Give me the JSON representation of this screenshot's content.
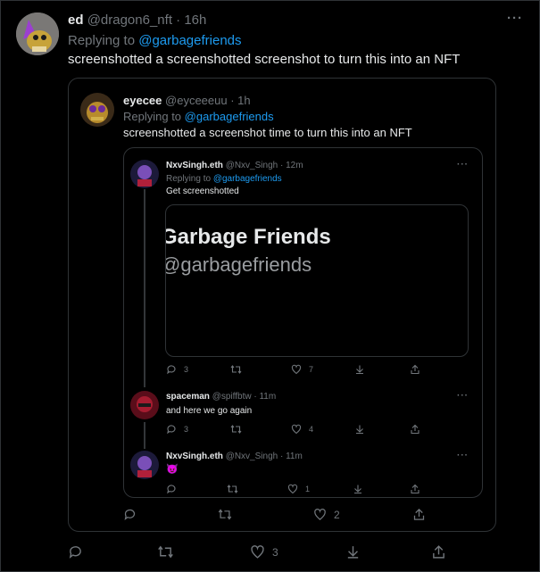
{
  "outer": {
    "name": "ed",
    "handle": "@dragon6_nft",
    "time": "· 16h",
    "replying_prefix": "Replying to",
    "replying_to": "@garbagefriends",
    "text": "screenshotted a screenshotted screenshot to turn this into an NFT",
    "actions": {
      "reply": "",
      "retweet": "",
      "like": "3",
      "share": ""
    }
  },
  "quote1": {
    "name": "eyecee",
    "handle": "@eyceeeuu",
    "time": "· 1h",
    "replying_prefix": "Replying to",
    "replying_to": "@garbagefriends",
    "text": "screenshotted a screenshot time to turn this into an NFT",
    "actions": {
      "reply": "",
      "retweet": "",
      "like": "2",
      "share": ""
    }
  },
  "thread": {
    "tweet1": {
      "name": "NxvSingh.eth",
      "handle": "@Nxv_Singh",
      "time": "· 12m",
      "replying_prefix": "Replying to",
      "replying_to": "@garbagefriends",
      "text": "Get screenshotted",
      "image_title": "Garbage Friends",
      "image_handle": "@garbagefriends",
      "actions": {
        "reply": "3",
        "retweet": "",
        "like": "7",
        "share": ""
      }
    },
    "tweet2": {
      "name": "spaceman",
      "handle": "@spiffbtw",
      "time": "· 11m",
      "text": "and here we go again",
      "actions": {
        "reply": "3",
        "retweet": "",
        "like": "4",
        "share": ""
      }
    },
    "tweet3": {
      "name": "NxvSingh.eth",
      "handle": "@Nxv_Singh",
      "time": "· 11m",
      "text": "😈",
      "actions": {
        "reply": "",
        "retweet": "",
        "like": "1",
        "share": ""
      }
    }
  },
  "more_glyph": "···",
  "colors": {
    "background": "#000000",
    "link": "#1d9bf0",
    "muted": "#71767b",
    "border": "#2f3336"
  }
}
